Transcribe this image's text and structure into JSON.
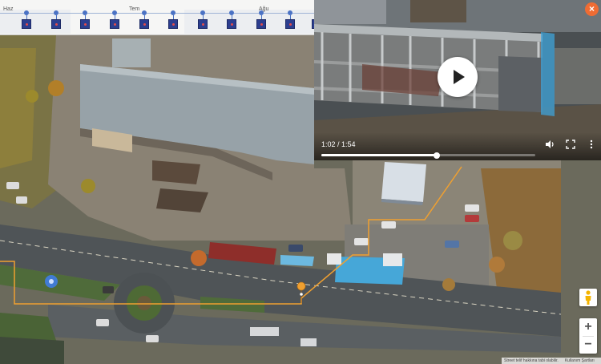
{
  "timeline": {
    "months": [
      "Haz",
      "Tem",
      "Ağu"
    ],
    "marker_count": 11
  },
  "video": {
    "time_label": "1:02 / 1:54",
    "progress": 0.54,
    "close_label": "×"
  },
  "map": {
    "zoom_in_label": "+",
    "zoom_out_label": "−",
    "attribution": "Street telif hakkına tabi olabilir.",
    "terms": "Kullanım Şartları"
  },
  "colors": {
    "accent": "#ef6c33",
    "route": "#f0a030",
    "timeline_marker": "#2c3e8f"
  }
}
